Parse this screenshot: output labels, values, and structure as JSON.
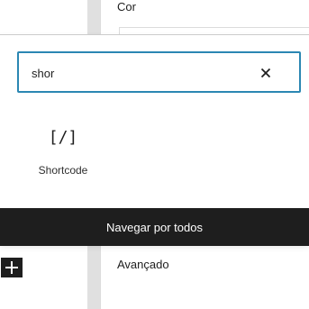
{
  "sidebar": {
    "color_label": "Cor",
    "advanced_label": "Avançado"
  },
  "inserter": {
    "search": {
      "value": "shor",
      "clear_icon": "close-icon"
    },
    "results": [
      {
        "icon_text": "[/]",
        "label": "Shortcode"
      }
    ],
    "browse_all_label": "Navegar por todos"
  },
  "editor": {
    "add_block_icon": "plus-icon"
  },
  "colors": {
    "accent": "#2b87b3",
    "dark": "#1e1e1e"
  }
}
